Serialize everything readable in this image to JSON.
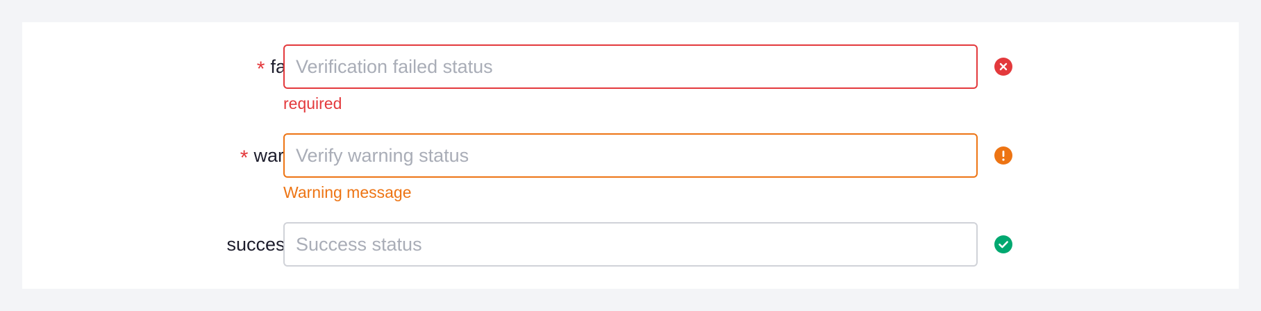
{
  "form": {
    "fields": [
      {
        "label": "fail",
        "required_mark": "*",
        "placeholder": "Verification failed status",
        "value": "",
        "status": "error",
        "status_icon": "close-circle-icon",
        "message": "required"
      },
      {
        "label": "warn",
        "required_mark": "*",
        "placeholder": "Verify warning status",
        "value": "",
        "status": "warning",
        "status_icon": "error-circle-icon",
        "message": "Warning message"
      },
      {
        "label": "success",
        "required_mark": "",
        "placeholder": "Success status",
        "value": "",
        "status": "success",
        "status_icon": "check-circle-icon",
        "message": ""
      }
    ]
  },
  "colors": {
    "error": "#e3393c",
    "warning": "#ed7413",
    "success": "#00a870",
    "background": "#f3f4f7"
  }
}
